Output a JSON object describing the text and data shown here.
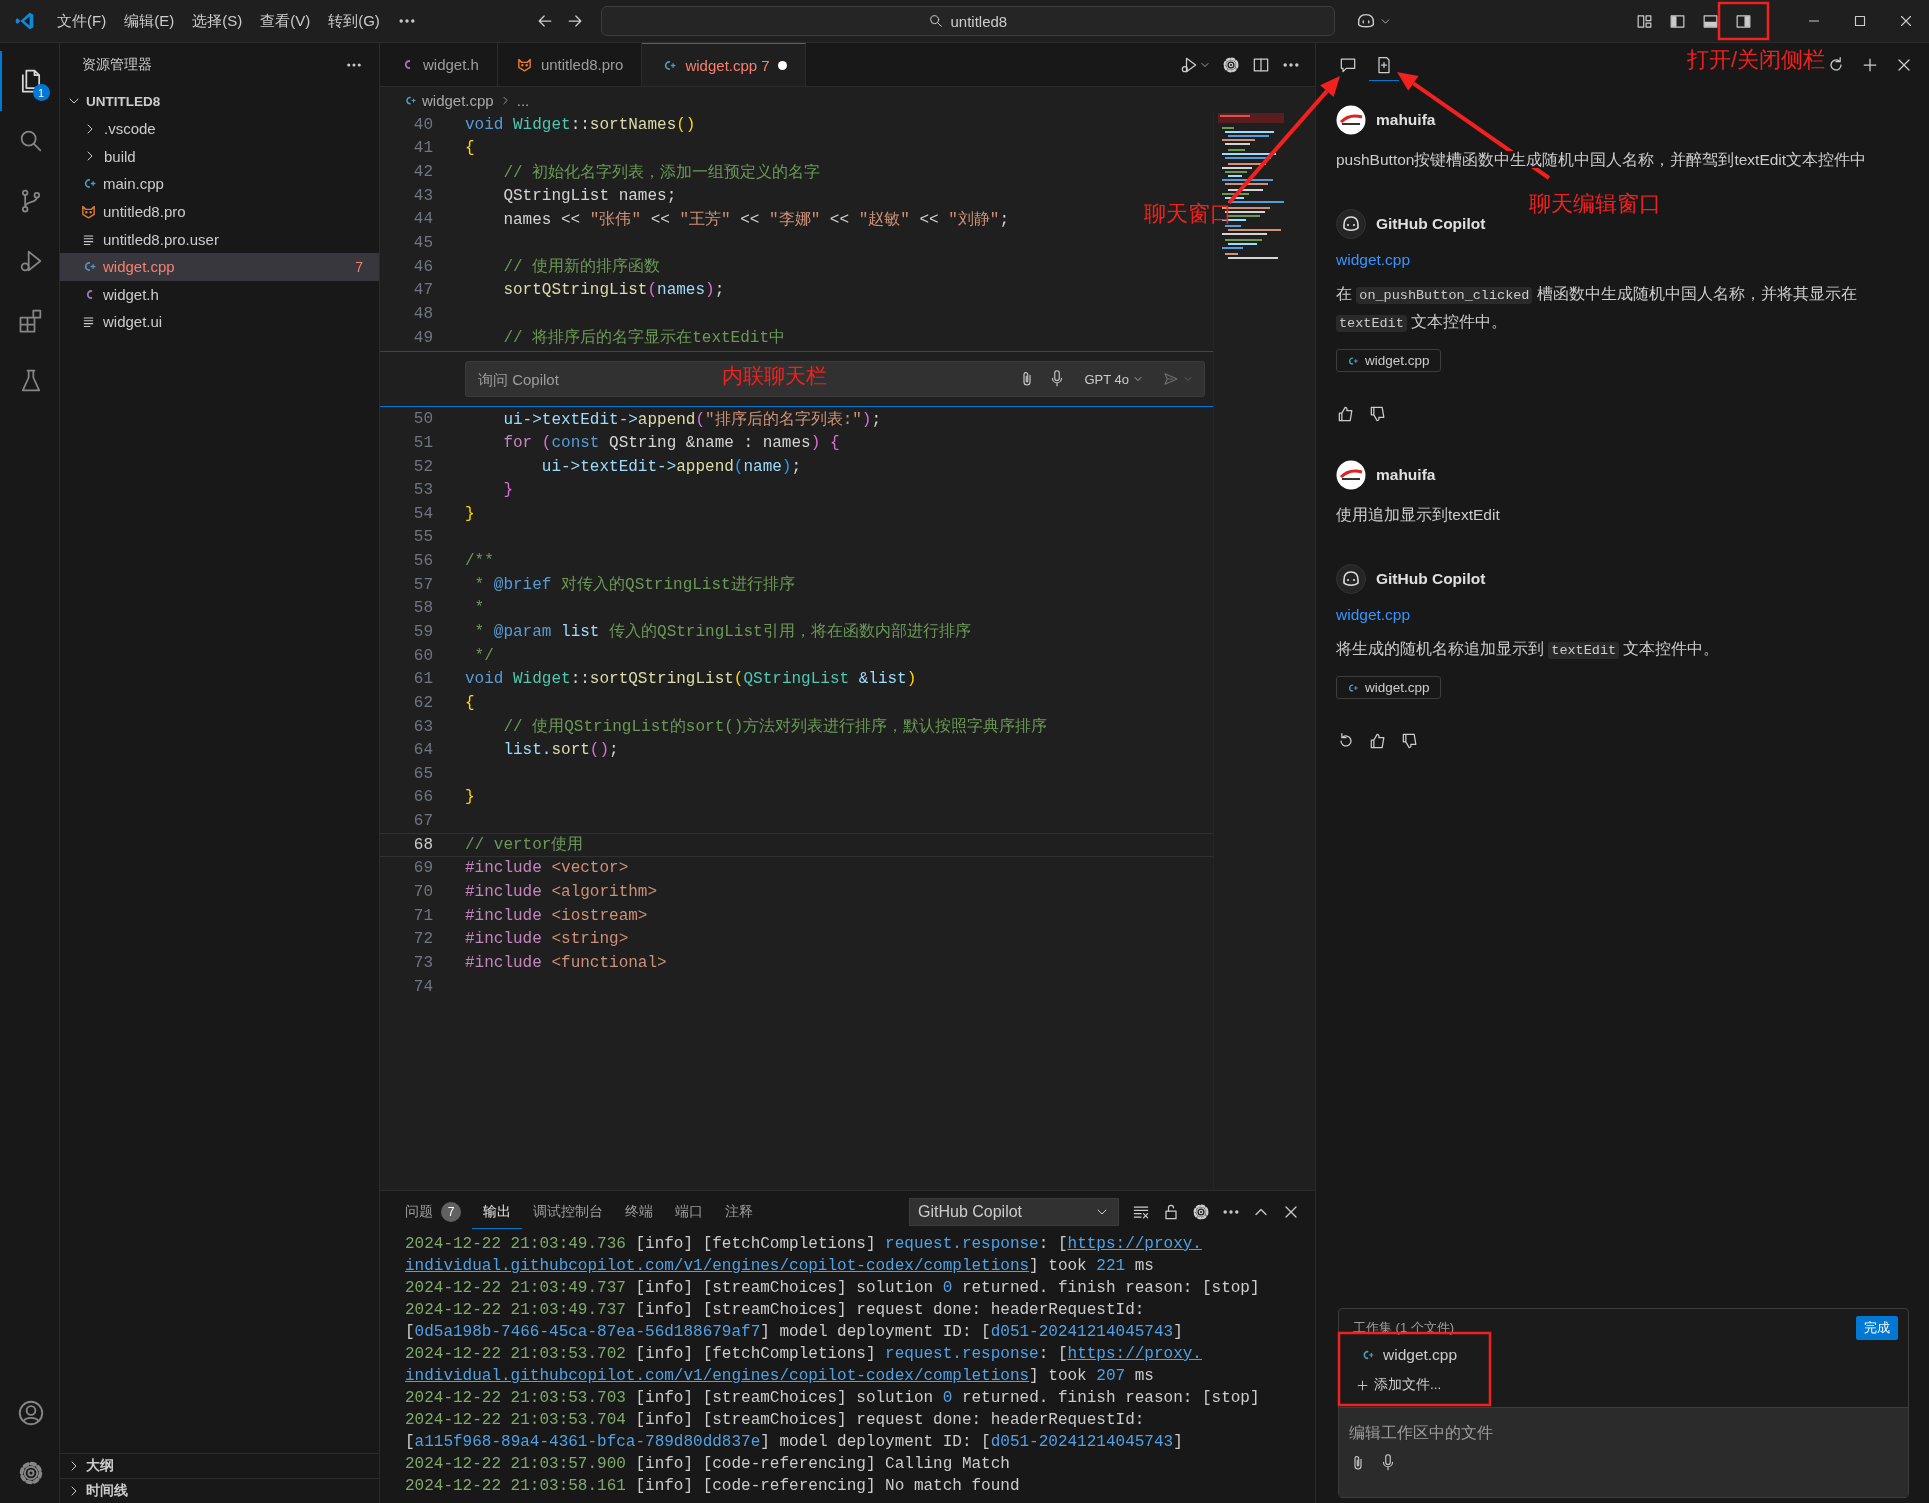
{
  "title_bar": {
    "menus": [
      "文件(F)",
      "编辑(E)",
      "选择(S)",
      "查看(V)",
      "转到(G)"
    ],
    "search": "untitled8"
  },
  "activity_bar": {
    "items": [
      {
        "kind": "files",
        "selected": true,
        "badge": "1"
      },
      {
        "kind": "search",
        "selected": false
      },
      {
        "kind": "scm",
        "selected": false
      },
      {
        "kind": "debug",
        "selected": false
      },
      {
        "kind": "extensions",
        "selected": false
      },
      {
        "kind": "flask",
        "selected": false
      }
    ],
    "bottom": [
      {
        "kind": "account"
      },
      {
        "kind": "gear"
      }
    ]
  },
  "sidebar": {
    "title": "资源管理器",
    "section": "UNTITLED8",
    "expanded": true,
    "items": [
      {
        "label": ".vscode",
        "kind": "folder",
        "selected": false,
        "has_errors": false
      },
      {
        "label": "build",
        "kind": "folder",
        "selected": false,
        "has_errors": false
      },
      {
        "label": "main.cpp",
        "kind": "cpp",
        "selected": false,
        "has_errors": false
      },
      {
        "label": "untitled8.pro",
        "kind": "pro",
        "selected": false,
        "has_errors": false
      },
      {
        "label": "untitled8.pro.user",
        "kind": "text",
        "selected": false,
        "has_errors": false
      },
      {
        "label": "widget.cpp",
        "kind": "cpp",
        "selected": true,
        "has_errors": true,
        "badge": "7"
      },
      {
        "label": "widget.h",
        "kind": "h",
        "selected": false,
        "has_errors": false
      },
      {
        "label": "widget.ui",
        "kind": "text",
        "selected": false,
        "has_errors": false
      }
    ],
    "panels": [
      {
        "label": "大纲",
        "expanded": false
      },
      {
        "label": "时间线",
        "expanded": false
      }
    ]
  },
  "editor": {
    "tabs": [
      {
        "label": "widget.h",
        "kind": "h",
        "selected": false,
        "has_errors": false,
        "dirty": false
      },
      {
        "label": "untitled8.pro",
        "kind": "pro",
        "selected": false,
        "has_errors": false,
        "dirty": false
      },
      {
        "label": "widget.cpp",
        "kind": "cpp",
        "selected": true,
        "has_errors": true,
        "dirty": true,
        "badge": "7"
      }
    ],
    "breadcrumb": [
      "widget.cpp",
      "..."
    ],
    "lines_top": [
      {
        "n": "40",
        "current": false,
        "tokens": [
          {
            "t": "void ",
            "kind": "kw"
          },
          {
            "t": "Widget",
            "kind": "type"
          },
          {
            "t": "::",
            "kind": "plain"
          },
          {
            "t": "sortNames",
            "kind": "fn"
          },
          {
            "t": "()",
            "kind": "br1"
          }
        ]
      },
      {
        "n": "41",
        "current": false,
        "tokens": [
          {
            "t": "{",
            "kind": "br1"
          }
        ]
      },
      {
        "n": "42",
        "current": false,
        "tokens": [
          {
            "t": "    // 初始化名字列表，添加一组预定义的名字",
            "kind": "cmt"
          }
        ]
      },
      {
        "n": "43",
        "current": false,
        "tokens": [
          {
            "t": "    QStringList names;",
            "kind": "plain"
          }
        ]
      },
      {
        "n": "44",
        "current": false,
        "tokens": [
          {
            "t": "    names << ",
            "kind": "plain"
          },
          {
            "t": "\"张伟\"",
            "kind": "str"
          },
          {
            "t": " << ",
            "kind": "plain"
          },
          {
            "t": "\"王芳\"",
            "kind": "str"
          },
          {
            "t": " << ",
            "kind": "plain"
          },
          {
            "t": "\"李娜\"",
            "kind": "str"
          },
          {
            "t": " << ",
            "kind": "plain"
          },
          {
            "t": "\"赵敏\"",
            "kind": "str"
          },
          {
            "t": " << ",
            "kind": "plain"
          },
          {
            "t": "\"刘静\"",
            "kind": "str"
          },
          {
            "t": ";",
            "kind": "plain"
          }
        ]
      },
      {
        "n": "45",
        "current": false
      },
      {
        "n": "46",
        "current": false,
        "tokens": [
          {
            "t": "    // 使用新的排序函数",
            "kind": "cmt"
          }
        ]
      },
      {
        "n": "47",
        "current": false,
        "tokens": [
          {
            "t": "    sortQStringList",
            "kind": "fn"
          },
          {
            "t": "(",
            "kind": "br2"
          },
          {
            "t": "names",
            "kind": "var"
          },
          {
            "t": ")",
            "kind": "br2"
          },
          {
            "t": ";",
            "kind": "plain"
          }
        ]
      },
      {
        "n": "48",
        "current": false
      },
      {
        "n": "49",
        "current": false,
        "tokens": [
          {
            "t": "    // 将排序后的名字显示在textEdit中",
            "kind": "cmt"
          }
        ]
      }
    ],
    "inline_chat": {
      "placeholder": "询问 Copilot",
      "model": "GPT 4o"
    },
    "lines_bottom": [
      {
        "n": "50",
        "current": false,
        "tokens": [
          {
            "t": "    ui->textEdit->",
            "kind": "var"
          },
          {
            "t": "append",
            "kind": "fn"
          },
          {
            "t": "(",
            "kind": "br2"
          },
          {
            "t": "\"排序后的名字列表:\"",
            "kind": "str"
          },
          {
            "t": ")",
            "kind": "br2"
          },
          {
            "t": ";",
            "kind": "plain"
          }
        ]
      },
      {
        "n": "51",
        "current": false,
        "tokens": [
          {
            "t": "    for ",
            "kind": "ctrl"
          },
          {
            "t": "(",
            "kind": "br2"
          },
          {
            "t": "const",
            "kind": "kw"
          },
          {
            "t": " QString &name : names",
            "kind": "plain"
          },
          {
            "t": ")",
            "kind": "br2"
          },
          {
            "t": " {",
            "kind": "br2"
          }
        ]
      },
      {
        "n": "52",
        "current": false,
        "tokens": [
          {
            "t": "        ui->textEdit->",
            "kind": "var"
          },
          {
            "t": "append",
            "kind": "fn"
          },
          {
            "t": "(",
            "kind": "br3"
          },
          {
            "t": "name",
            "kind": "var"
          },
          {
            "t": ")",
            "kind": "br3"
          },
          {
            "t": ";",
            "kind": "plain"
          }
        ]
      },
      {
        "n": "53",
        "current": false,
        "tokens": [
          {
            "t": "    }",
            "kind": "br2"
          }
        ]
      },
      {
        "n": "54",
        "current": false,
        "tokens": [
          {
            "t": "}",
            "kind": "br1"
          }
        ]
      },
      {
        "n": "55",
        "current": false
      },
      {
        "n": "56",
        "current": false,
        "tokens": [
          {
            "t": "/**",
            "kind": "cmt"
          }
        ]
      },
      {
        "n": "57",
        "current": false,
        "tokens": [
          {
            "t": " * ",
            "kind": "cmt"
          },
          {
            "t": "@brief",
            "kind": "kw"
          },
          {
            "t": " 对传入的QStringList进行排序",
            "kind": "cmt"
          }
        ]
      },
      {
        "n": "58",
        "current": false,
        "tokens": [
          {
            "t": " *",
            "kind": "cmt"
          }
        ]
      },
      {
        "n": "59",
        "current": false,
        "tokens": [
          {
            "t": " * ",
            "kind": "cmt"
          },
          {
            "t": "@param",
            "kind": "kw"
          },
          {
            "t": " list",
            "kind": "var"
          },
          {
            "t": " 传入的QStringList引用，将在函数内部进行排序",
            "kind": "cmt"
          }
        ]
      },
      {
        "n": "60",
        "current": false,
        "tokens": [
          {
            "t": " */",
            "kind": "cmt"
          }
        ]
      },
      {
        "n": "61",
        "current": false,
        "tokens": [
          {
            "t": "void ",
            "kind": "kw"
          },
          {
            "t": "Widget",
            "kind": "type"
          },
          {
            "t": "::",
            "kind": "plain"
          },
          {
            "t": "sortQStringList",
            "kind": "fn"
          },
          {
            "t": "(",
            "kind": "br1"
          },
          {
            "t": "QStringList",
            "kind": "type"
          },
          {
            "t": " &list",
            "kind": "var"
          },
          {
            "t": ")",
            "kind": "br1"
          }
        ]
      },
      {
        "n": "62",
        "current": false,
        "tokens": [
          {
            "t": "{",
            "kind": "br1"
          }
        ]
      },
      {
        "n": "63",
        "current": false,
        "tokens": [
          {
            "t": "    // 使用QStringList的sort()方法对列表进行排序，默认按照字典序排序",
            "kind": "cmt"
          }
        ]
      },
      {
        "n": "64",
        "current": false,
        "tokens": [
          {
            "t": "    list.",
            "kind": "var"
          },
          {
            "t": "sort",
            "kind": "fn"
          },
          {
            "t": "()",
            "kind": "br2"
          },
          {
            "t": ";",
            "kind": "plain"
          }
        ]
      },
      {
        "n": "65",
        "current": false
      },
      {
        "n": "66",
        "current": false,
        "tokens": [
          {
            "t": "}",
            "kind": "br1"
          }
        ]
      },
      {
        "n": "67",
        "current": false
      },
      {
        "n": "68",
        "current": true,
        "tokens": [
          {
            "t": "// vertor使用",
            "kind": "cmt"
          }
        ]
      },
      {
        "n": "69",
        "current": false,
        "tokens": [
          {
            "t": "#include ",
            "kind": "ctrl"
          },
          {
            "t": "<vector>",
            "kind": "str"
          }
        ]
      },
      {
        "n": "70",
        "current": false,
        "tokens": [
          {
            "t": "#include ",
            "kind": "ctrl"
          },
          {
            "t": "<algorithm>",
            "kind": "str"
          }
        ]
      },
      {
        "n": "71",
        "current": false,
        "tokens": [
          {
            "t": "#include ",
            "kind": "ctrl"
          },
          {
            "t": "<iostream>",
            "kind": "str"
          }
        ]
      },
      {
        "n": "72",
        "current": false,
        "tokens": [
          {
            "t": "#include ",
            "kind": "ctrl"
          },
          {
            "t": "<string>",
            "kind": "str"
          }
        ]
      },
      {
        "n": "73",
        "current": false,
        "tokens": [
          {
            "t": "#include ",
            "kind": "ctrl"
          },
          {
            "t": "<functional>",
            "kind": "str"
          }
        ]
      },
      {
        "n": "74",
        "current": false
      }
    ]
  },
  "panel": {
    "tabs": [
      {
        "label": "问题",
        "selected": false,
        "badge": "7"
      },
      {
        "label": "输出",
        "selected": true
      },
      {
        "label": "调试控制台",
        "selected": false
      },
      {
        "label": "终端",
        "selected": false
      },
      {
        "label": "端口",
        "selected": false
      },
      {
        "label": "注释",
        "selected": false
      }
    ],
    "channel": "GitHub Copilot",
    "output": [
      {
        "tokens": [
          {
            "t": "2024-12-22 21:03:49.736",
            "kind": "ts"
          },
          {
            "t": " [info] [fetchCompletions] ",
            "kind": "plain"
          },
          {
            "t": "request.response",
            "kind": "key"
          },
          {
            "t": ": [",
            "kind": "plain"
          },
          {
            "t": "https://proxy.",
            "kind": "link"
          }
        ]
      },
      {
        "tokens": [
          {
            "t": "individual.githubcopilot.com/v1/engines/copilot-codex/completions",
            "kind": "link"
          },
          {
            "t": "] took ",
            "kind": "plain"
          },
          {
            "t": "221",
            "kind": "key"
          },
          {
            "t": " ms",
            "kind": "plain"
          }
        ]
      },
      {
        "tokens": [
          {
            "t": "2024-12-22 21:03:49.737",
            "kind": "ts"
          },
          {
            "t": " [info] [streamChoices] solution ",
            "kind": "plain"
          },
          {
            "t": "0",
            "kind": "key"
          },
          {
            "t": " returned. finish reason: [stop]",
            "kind": "plain"
          }
        ]
      },
      {
        "tokens": [
          {
            "t": "2024-12-22 21:03:49.737",
            "kind": "ts"
          },
          {
            "t": " [info] [streamChoices] request done: headerRequestId:",
            "kind": "plain"
          }
        ]
      },
      {
        "tokens": [
          {
            "t": "[",
            "kind": "plain"
          },
          {
            "t": "0d5a198b-7466-45ca-87ea-56d188679af7",
            "kind": "key"
          },
          {
            "t": "] model deployment ID: [",
            "kind": "plain"
          },
          {
            "t": "d051-20241214045743",
            "kind": "key"
          },
          {
            "t": "]",
            "kind": "plain"
          }
        ]
      },
      {
        "tokens": [
          {
            "t": "2024-12-22 21:03:53.702",
            "kind": "ts"
          },
          {
            "t": " [info] [fetchCompletions] ",
            "kind": "plain"
          },
          {
            "t": "request.response",
            "kind": "key"
          },
          {
            "t": ": [",
            "kind": "plain"
          },
          {
            "t": "https://proxy.",
            "kind": "link"
          }
        ]
      },
      {
        "tokens": [
          {
            "t": "individual.githubcopilot.com/v1/engines/copilot-codex/completions",
            "kind": "link"
          },
          {
            "t": "] took ",
            "kind": "plain"
          },
          {
            "t": "207",
            "kind": "key"
          },
          {
            "t": " ms",
            "kind": "plain"
          }
        ]
      },
      {
        "tokens": [
          {
            "t": "2024-12-22 21:03:53.703",
            "kind": "ts"
          },
          {
            "t": " [info] [streamChoices] solution ",
            "kind": "plain"
          },
          {
            "t": "0",
            "kind": "key"
          },
          {
            "t": " returned. finish reason: [stop]",
            "kind": "plain"
          }
        ]
      },
      {
        "tokens": [
          {
            "t": "2024-12-22 21:03:53.704",
            "kind": "ts"
          },
          {
            "t": " [info] [streamChoices] request done: headerRequestId:",
            "kind": "plain"
          }
        ]
      },
      {
        "tokens": [
          {
            "t": "[",
            "kind": "plain"
          },
          {
            "t": "a115f968-89a4-4361-bfca-789d80dd837e",
            "kind": "key"
          },
          {
            "t": "] model deployment ID: [",
            "kind": "plain"
          },
          {
            "t": "d051-20241214045743",
            "kind": "key"
          },
          {
            "t": "]",
            "kind": "plain"
          }
        ]
      },
      {
        "tokens": [
          {
            "t": "2024-12-22 21:03:57.900",
            "kind": "ts"
          },
          {
            "t": " [info] [code-referencing] Calling Match",
            "kind": "plain"
          }
        ]
      },
      {
        "tokens": [
          {
            "t": "2024-12-22 21:03:58.161",
            "kind": "ts"
          },
          {
            "t": " [info] [code-referencing] No match found",
            "kind": "plain"
          }
        ]
      }
    ]
  },
  "chat": {
    "tabs": [
      {
        "kind": "chat",
        "selected": false
      },
      {
        "kind": "edits",
        "selected": true
      }
    ],
    "messages": [
      {
        "kind": "user",
        "author": "mahuifa",
        "parts": [
          {
            "t": "pushButton按键槽函数中生成随机中国人名称，并醉驾到textEdit文本控件中",
            "kind": "text"
          }
        ]
      },
      {
        "kind": "assistant",
        "author": "GitHub Copilot",
        "link": "widget.cpp",
        "parts": [
          {
            "t": "在 ",
            "kind": "text"
          },
          {
            "t": "on_pushButton_clicked",
            "kind": "code"
          },
          {
            "t": " 槽函数中生成随机中国人名称，并将其显示在 ",
            "kind": "text"
          },
          {
            "t": "textEdit",
            "kind": "code"
          },
          {
            "t": " 文本控件中。",
            "kind": "text"
          }
        ],
        "file": "widget.cpp",
        "can_retry": false
      },
      {
        "kind": "user",
        "author": "mahuifa",
        "parts": [
          {
            "t": "使用追加显示到textEdit",
            "kind": "text"
          }
        ]
      },
      {
        "kind": "assistant",
        "author": "GitHub Copilot",
        "link": "widget.cpp",
        "parts": [
          {
            "t": "将生成的随机名称追加显示到 ",
            "kind": "text"
          },
          {
            "t": "textEdit",
            "kind": "code"
          },
          {
            "t": " 文本控件中。",
            "kind": "text"
          }
        ],
        "file": "widget.cpp",
        "can_retry": true
      }
    ],
    "working_set": {
      "title": "工作集 (1 个文件)",
      "done": "完成",
      "files": [
        "widget.cpp"
      ],
      "add": "添加文件...",
      "placeholder": "编辑工作区中的文件"
    }
  },
  "annotations": [
    {
      "text": "打开/关闭侧栏"
    },
    {
      "text": "聊天窗口"
    },
    {
      "text": "聊天编辑窗口"
    },
    {
      "text": "内联聊天栏"
    }
  ]
}
